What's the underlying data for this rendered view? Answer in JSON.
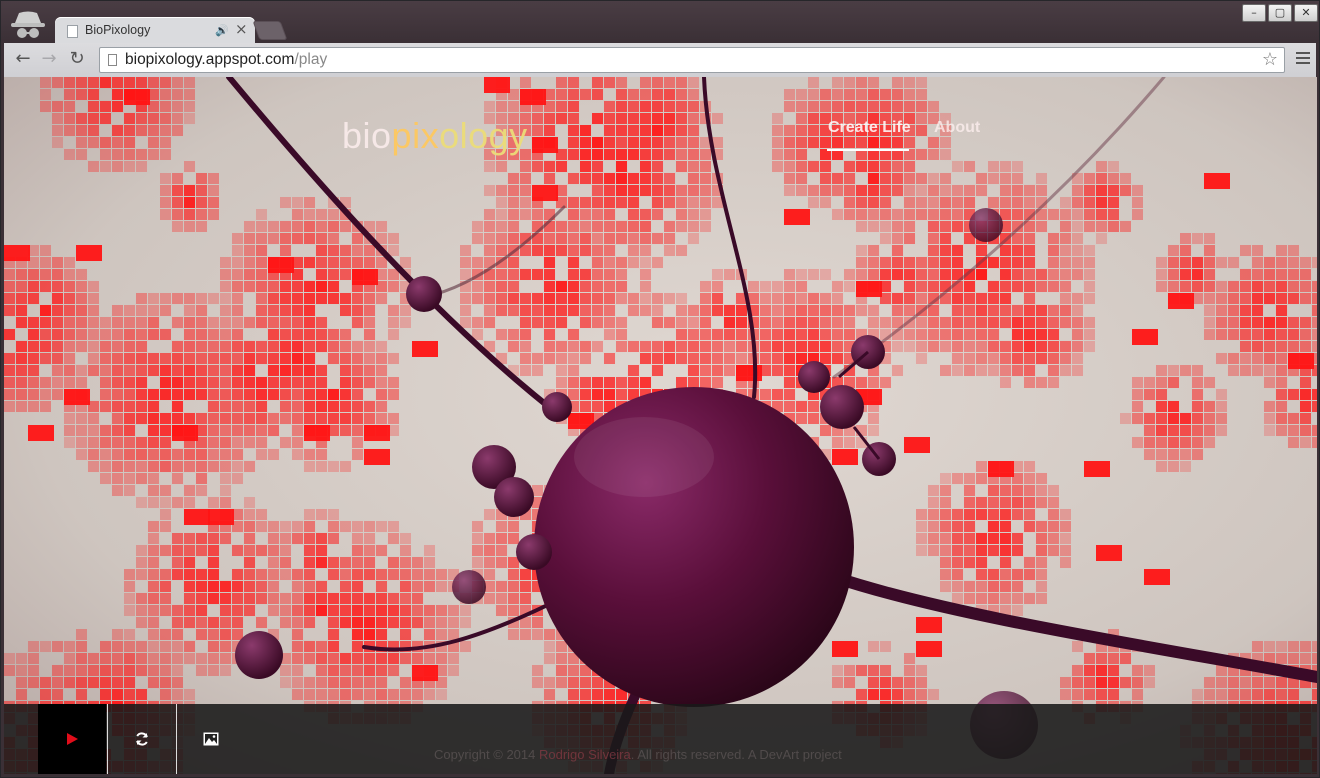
{
  "browser": {
    "tab_title": "BioPixology",
    "url_host": "biopixology.appspot.com",
    "url_path": "/play",
    "window_buttons": [
      "–",
      "▢",
      "✕"
    ]
  },
  "site": {
    "logo_parts": [
      "bio",
      "pix",
      "ology"
    ],
    "nav": {
      "create_life": "Create Life",
      "about": "About"
    },
    "footer": {
      "copyright": "Copyright © 2014",
      "author": "Rodrigo Silveira",
      "rights": ". All rights reserved.",
      "project": "A DevArt project"
    },
    "controls": [
      "play-icon",
      "reload-icon",
      "image-icon"
    ]
  },
  "colors": {
    "pixel_red": "#ff1414",
    "orb": "#5a0f3a",
    "bar": "#191919"
  }
}
